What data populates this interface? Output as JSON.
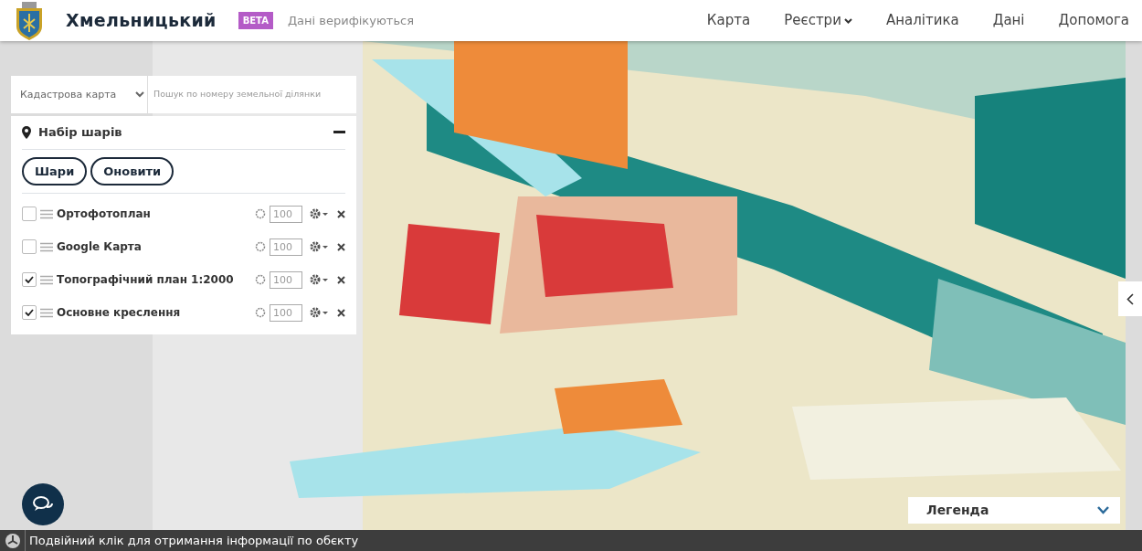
{
  "header": {
    "brand": "Хмельницький",
    "badge": "BETA",
    "status": "Дані верифікуються"
  },
  "nav": [
    {
      "label": "Карта",
      "dropdown": false
    },
    {
      "label": "Реєстри",
      "dropdown": true
    },
    {
      "label": "Аналітика",
      "dropdown": false
    },
    {
      "label": "Дані",
      "dropdown": false
    },
    {
      "label": "Допомога",
      "dropdown": false
    }
  ],
  "map_selector": {
    "value": "Кадастрова карта",
    "search_placeholder": "Пошук по номеру земельної ділянки"
  },
  "layers_panel": {
    "title": "Набір шарів",
    "buttons": [
      "Шари",
      "Оновити"
    ],
    "layers": [
      {
        "label": "Ортофотоплан",
        "checked": false,
        "opacity": "100"
      },
      {
        "label": "Google Карта",
        "checked": false,
        "opacity": "100"
      },
      {
        "label": "Топографічний план 1:2000",
        "checked": true,
        "opacity": "100"
      },
      {
        "label": "Основне креслення",
        "checked": true,
        "opacity": "100"
      }
    ]
  },
  "legend": {
    "title": "Легенда"
  },
  "status_bar": {
    "text": "Подвійний клік для отримання інформації по обєкту"
  }
}
